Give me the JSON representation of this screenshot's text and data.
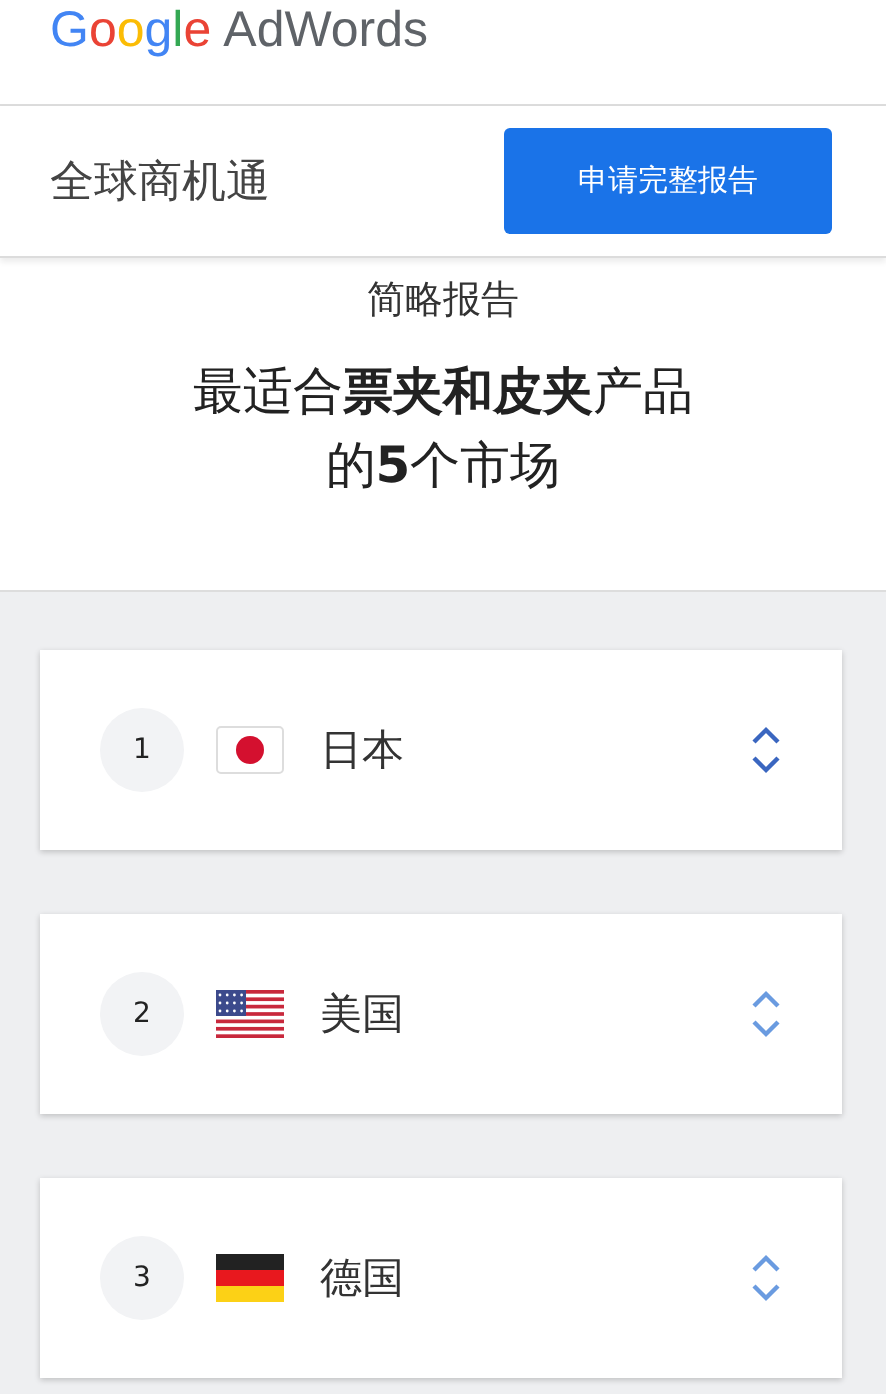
{
  "logo": {
    "brand": "Google",
    "product": "AdWords"
  },
  "header": {
    "title": "全球商机通",
    "button": "申请完整报告"
  },
  "summary": {
    "subtitle": "简略报告",
    "headline": [
      "最适合**票夹和皮夹**产品",
      "的**5**个市场"
    ]
  },
  "markets": [
    {
      "rank": "1",
      "name": "日本"
    },
    {
      "rank": "2",
      "name": "美国"
    },
    {
      "rank": "3",
      "name": "德国"
    }
  ]
}
